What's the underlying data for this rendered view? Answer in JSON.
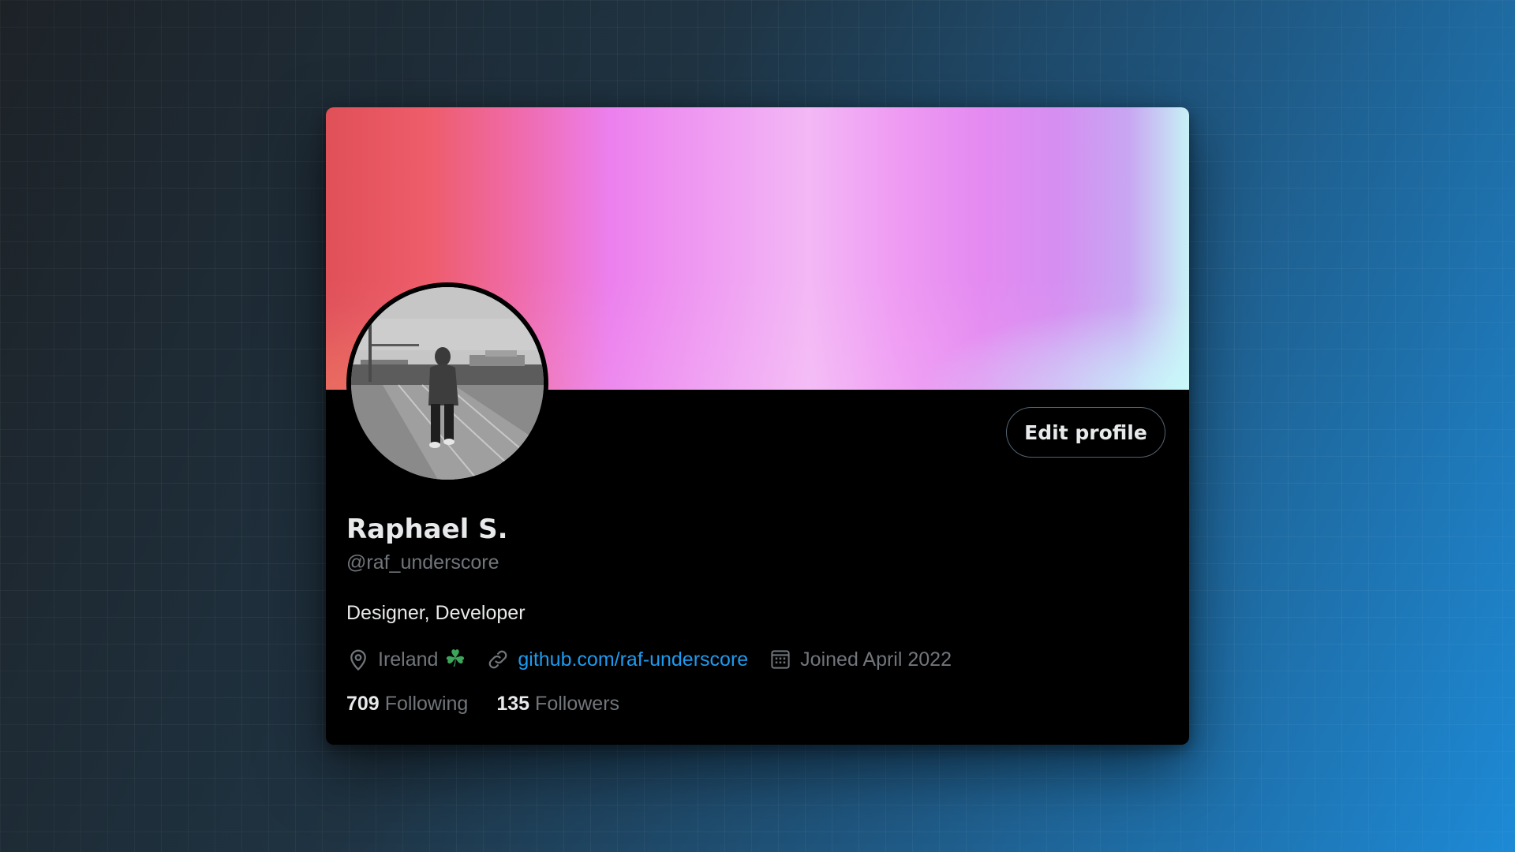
{
  "profile": {
    "name": "Raphael S.",
    "handle": "@raf_underscore",
    "bio": "Designer, Developer",
    "edit_button_label": "Edit profile",
    "location": "Ireland",
    "location_emoji": "☘",
    "website": "github.com/raf-underscore",
    "joined": "Joined April 2022",
    "following_count": "709",
    "following_label": "Following",
    "followers_count": "135",
    "followers_label": "Followers"
  },
  "icons": {
    "location": "location-pin-icon",
    "link": "link-icon",
    "calendar": "calendar-icon"
  },
  "colors": {
    "link": "#1d9bf0",
    "muted_text": "#71767b",
    "primary_text": "#e7e9ea",
    "card_background": "#000000"
  }
}
